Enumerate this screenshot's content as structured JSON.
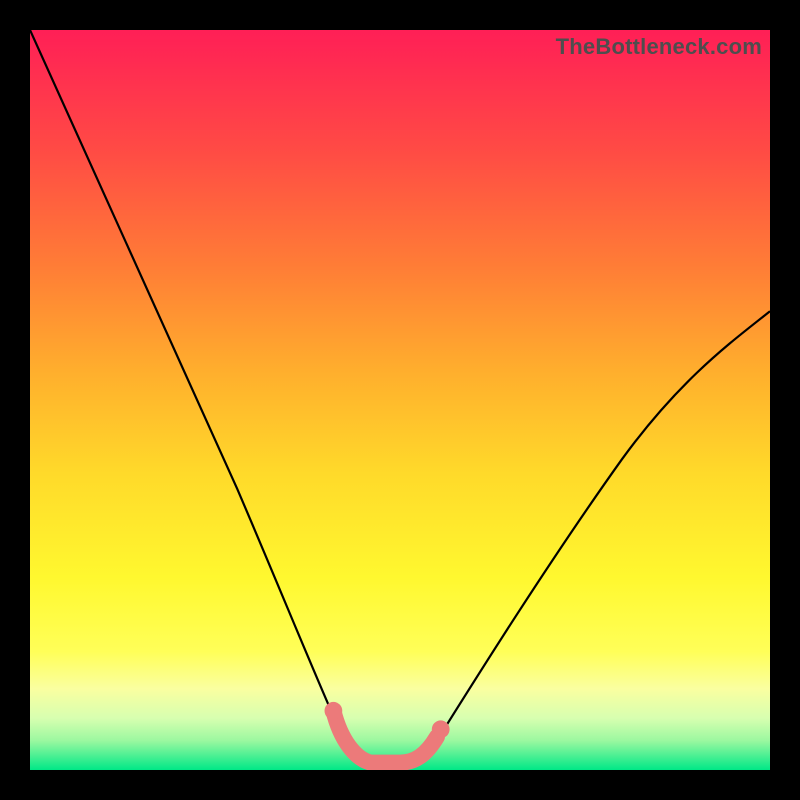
{
  "watermark": "TheBottleneck.com",
  "chart_data": {
    "type": "line",
    "title": "",
    "xlabel": "",
    "ylabel": "",
    "xlim": [
      0,
      100
    ],
    "ylim": [
      0,
      100
    ],
    "series": [
      {
        "name": "bottleneck-curve",
        "x": [
          0,
          5,
          10,
          15,
          20,
          25,
          30,
          35,
          40,
          43,
          46,
          50,
          53,
          55,
          60,
          65,
          70,
          75,
          80,
          85,
          90,
          95,
          100
        ],
        "values": [
          100,
          88,
          76,
          64,
          53,
          42,
          31,
          20,
          9,
          3,
          1,
          1,
          1,
          3,
          9,
          16,
          22,
          29,
          35,
          41,
          48,
          55,
          62
        ]
      }
    ],
    "highlight_zone": {
      "x_start": 41,
      "x_end": 55
    },
    "background_gradient": {
      "top_color": "#ff1f56",
      "mid_colors": [
        "#ff6b37",
        "#ffb02e",
        "#ffe72b",
        "#ffff4d",
        "#f8ff7d"
      ],
      "bottom_color": "#00e887"
    }
  }
}
